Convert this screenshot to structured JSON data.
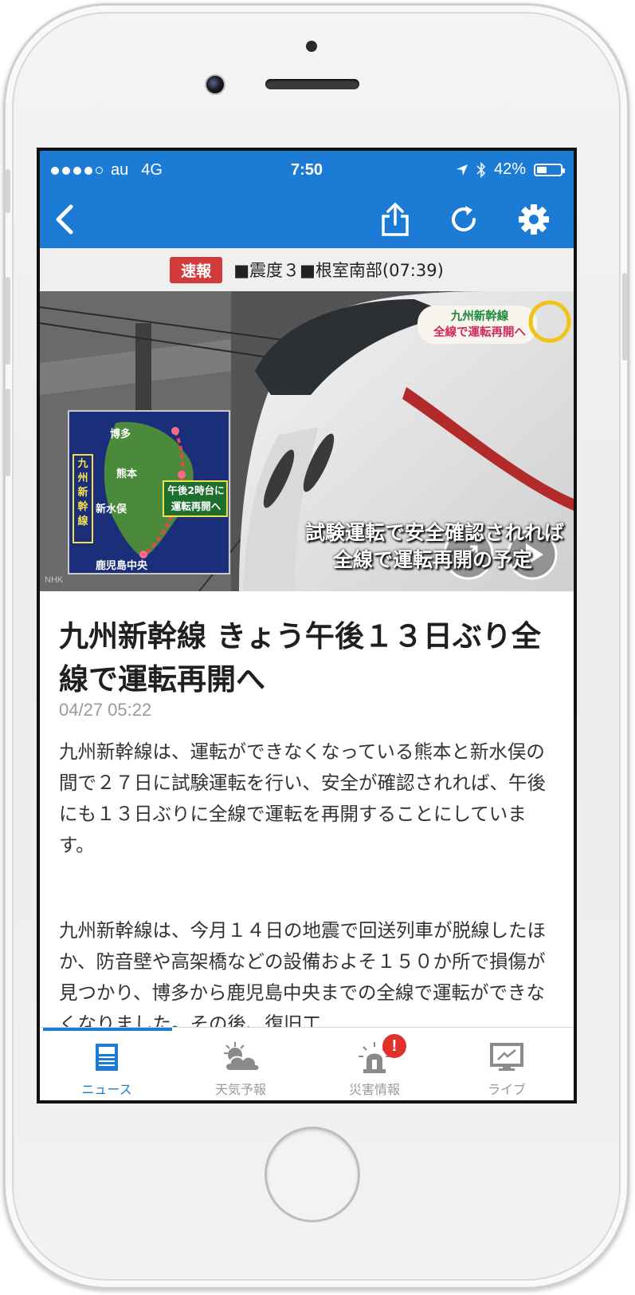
{
  "status_bar": {
    "carrier": "au",
    "network": "4G",
    "time": "7:50",
    "battery_percent_text": "42%",
    "battery_level": 0.42
  },
  "ticker": {
    "badge": "速報",
    "text": "■震度３■根室南部(07:39)"
  },
  "video": {
    "caption_top": "九州新幹線\n全線で運転再開へ",
    "caption_top_line1": "九州新幹線",
    "caption_top_line2": "全線で運転再開へ",
    "caption_bottom_line1": "試験運転で安全確認されれば",
    "caption_bottom_line2": "全線で運転再開の予定",
    "map_title": "九州新幹線",
    "map_stations": [
      "博多",
      "熊本",
      "新水俣",
      "鹿児島中央"
    ],
    "map_callout_line1": "午後2時台に",
    "map_callout_line2": "運転再開へ",
    "watermark": "NHK"
  },
  "article": {
    "headline": "九州新幹線 きょう午後１３日ぶり全線で運転再開へ",
    "date": "04/27 05:22",
    "paragraph1": "九州新幹線は、運転ができなくなっている熊本と新水俣の間で２７日に試験運転を行い、安全が確認されれば、午後にも１３日ぶりに全線で運転を再開することにしています。",
    "paragraph2": "九州新幹線は、今月１４日の地震で回送列車が脱線したほか、防音壁や高架橋などの設備およそ１５０か所で損傷が見つかり、博多から鹿児島中央までの全線で運転ができなくなりました。その後、復旧工"
  },
  "tabs": [
    {
      "label": "ニュース",
      "icon": "newspaper-icon",
      "active": true
    },
    {
      "label": "天気予報",
      "icon": "weather-icon",
      "active": false
    },
    {
      "label": "災害情報",
      "icon": "siren-icon",
      "active": false,
      "alert": "!"
    },
    {
      "label": "ライブ",
      "icon": "tv-icon",
      "active": false
    }
  ],
  "colors": {
    "accent": "#1c7bd4",
    "alert": "#d23b3b"
  }
}
